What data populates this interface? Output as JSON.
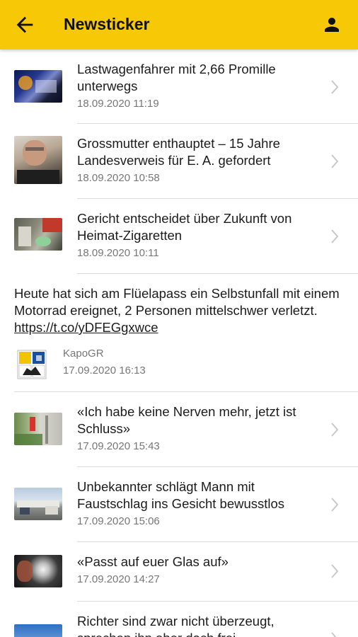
{
  "appbar": {
    "title": "Newsticker",
    "back_icon": "arrow-left-icon",
    "user_icon": "person-icon",
    "color": "#f7c806"
  },
  "items": [
    {
      "headline": "Lastwagenfahrer mit 2,66 Promille unterwegs",
      "date": "18.09.2020 11:19"
    },
    {
      "headline": "Grossmutter enthauptet – 15 Jahre Landesverweis für E. A. gefordert",
      "date": "18.09.2020 10:58"
    },
    {
      "headline": "Gericht entscheidet über Zukunft von Heimat-Zigaretten",
      "date": "18.09.2020 10:11"
    }
  ],
  "tweet": {
    "text": "Heute hat sich am Flüelapass ein Selbstunfall mit einem Motorrad ereignet, 2 Personen mittelschwer verletzt.",
    "link": "https://t.co/yDFEGgxwce",
    "author": "KapoGR",
    "date": "17.09.2020 16:13"
  },
  "items2": [
    {
      "headline": "«Ich habe keine Nerven mehr, jetzt ist Schluss»",
      "date": "17.09.2020 15:43"
    },
    {
      "headline": "Unbekannter schlägt Mann mit Faustschlag ins Gesicht bewusstlos",
      "date": "17.09.2020 15:06"
    },
    {
      "headline": "«Passt auf euer Glas auf»",
      "date": "17.09.2020 14:27"
    },
    {
      "headline": "Richter sind zwar nicht überzeugt, sprechen ihn aber doch frei",
      "date": ""
    }
  ]
}
